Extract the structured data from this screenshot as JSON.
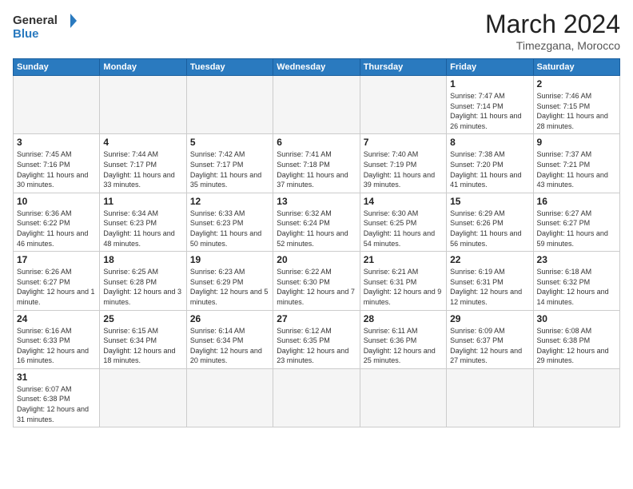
{
  "header": {
    "logo_general": "General",
    "logo_blue": "Blue",
    "month_title": "March 2024",
    "subtitle": "Timezgana, Morocco"
  },
  "days_of_week": [
    "Sunday",
    "Monday",
    "Tuesday",
    "Wednesday",
    "Thursday",
    "Friday",
    "Saturday"
  ],
  "weeks": [
    [
      {
        "day": "",
        "info": ""
      },
      {
        "day": "",
        "info": ""
      },
      {
        "day": "",
        "info": ""
      },
      {
        "day": "",
        "info": ""
      },
      {
        "day": "",
        "info": ""
      },
      {
        "day": "1",
        "info": "Sunrise: 7:47 AM\nSunset: 7:14 PM\nDaylight: 11 hours\nand 26 minutes."
      },
      {
        "day": "2",
        "info": "Sunrise: 7:46 AM\nSunset: 7:15 PM\nDaylight: 11 hours\nand 28 minutes."
      }
    ],
    [
      {
        "day": "3",
        "info": "Sunrise: 7:45 AM\nSunset: 7:16 PM\nDaylight: 11 hours\nand 30 minutes."
      },
      {
        "day": "4",
        "info": "Sunrise: 7:44 AM\nSunset: 7:17 PM\nDaylight: 11 hours\nand 33 minutes."
      },
      {
        "day": "5",
        "info": "Sunrise: 7:42 AM\nSunset: 7:17 PM\nDaylight: 11 hours\nand 35 minutes."
      },
      {
        "day": "6",
        "info": "Sunrise: 7:41 AM\nSunset: 7:18 PM\nDaylight: 11 hours\nand 37 minutes."
      },
      {
        "day": "7",
        "info": "Sunrise: 7:40 AM\nSunset: 7:19 PM\nDaylight: 11 hours\nand 39 minutes."
      },
      {
        "day": "8",
        "info": "Sunrise: 7:38 AM\nSunset: 7:20 PM\nDaylight: 11 hours\nand 41 minutes."
      },
      {
        "day": "9",
        "info": "Sunrise: 7:37 AM\nSunset: 7:21 PM\nDaylight: 11 hours\nand 43 minutes."
      }
    ],
    [
      {
        "day": "10",
        "info": "Sunrise: 6:36 AM\nSunset: 6:22 PM\nDaylight: 11 hours\nand 46 minutes."
      },
      {
        "day": "11",
        "info": "Sunrise: 6:34 AM\nSunset: 6:23 PM\nDaylight: 11 hours\nand 48 minutes."
      },
      {
        "day": "12",
        "info": "Sunrise: 6:33 AM\nSunset: 6:23 PM\nDaylight: 11 hours\nand 50 minutes."
      },
      {
        "day": "13",
        "info": "Sunrise: 6:32 AM\nSunset: 6:24 PM\nDaylight: 11 hours\nand 52 minutes."
      },
      {
        "day": "14",
        "info": "Sunrise: 6:30 AM\nSunset: 6:25 PM\nDaylight: 11 hours\nand 54 minutes."
      },
      {
        "day": "15",
        "info": "Sunrise: 6:29 AM\nSunset: 6:26 PM\nDaylight: 11 hours\nand 56 minutes."
      },
      {
        "day": "16",
        "info": "Sunrise: 6:27 AM\nSunset: 6:27 PM\nDaylight: 11 hours\nand 59 minutes."
      }
    ],
    [
      {
        "day": "17",
        "info": "Sunrise: 6:26 AM\nSunset: 6:27 PM\nDaylight: 12 hours\nand 1 minute."
      },
      {
        "day": "18",
        "info": "Sunrise: 6:25 AM\nSunset: 6:28 PM\nDaylight: 12 hours\nand 3 minutes."
      },
      {
        "day": "19",
        "info": "Sunrise: 6:23 AM\nSunset: 6:29 PM\nDaylight: 12 hours\nand 5 minutes."
      },
      {
        "day": "20",
        "info": "Sunrise: 6:22 AM\nSunset: 6:30 PM\nDaylight: 12 hours\nand 7 minutes."
      },
      {
        "day": "21",
        "info": "Sunrise: 6:21 AM\nSunset: 6:31 PM\nDaylight: 12 hours\nand 9 minutes."
      },
      {
        "day": "22",
        "info": "Sunrise: 6:19 AM\nSunset: 6:31 PM\nDaylight: 12 hours\nand 12 minutes."
      },
      {
        "day": "23",
        "info": "Sunrise: 6:18 AM\nSunset: 6:32 PM\nDaylight: 12 hours\nand 14 minutes."
      }
    ],
    [
      {
        "day": "24",
        "info": "Sunrise: 6:16 AM\nSunset: 6:33 PM\nDaylight: 12 hours\nand 16 minutes."
      },
      {
        "day": "25",
        "info": "Sunrise: 6:15 AM\nSunset: 6:34 PM\nDaylight: 12 hours\nand 18 minutes."
      },
      {
        "day": "26",
        "info": "Sunrise: 6:14 AM\nSunset: 6:34 PM\nDaylight: 12 hours\nand 20 minutes."
      },
      {
        "day": "27",
        "info": "Sunrise: 6:12 AM\nSunset: 6:35 PM\nDaylight: 12 hours\nand 23 minutes."
      },
      {
        "day": "28",
        "info": "Sunrise: 6:11 AM\nSunset: 6:36 PM\nDaylight: 12 hours\nand 25 minutes."
      },
      {
        "day": "29",
        "info": "Sunrise: 6:09 AM\nSunset: 6:37 PM\nDaylight: 12 hours\nand 27 minutes."
      },
      {
        "day": "30",
        "info": "Sunrise: 6:08 AM\nSunset: 6:38 PM\nDaylight: 12 hours\nand 29 minutes."
      }
    ],
    [
      {
        "day": "31",
        "info": "Sunrise: 6:07 AM\nSunset: 6:38 PM\nDaylight: 12 hours\nand 31 minutes."
      },
      {
        "day": "",
        "info": ""
      },
      {
        "day": "",
        "info": ""
      },
      {
        "day": "",
        "info": ""
      },
      {
        "day": "",
        "info": ""
      },
      {
        "day": "",
        "info": ""
      },
      {
        "day": "",
        "info": ""
      }
    ]
  ]
}
